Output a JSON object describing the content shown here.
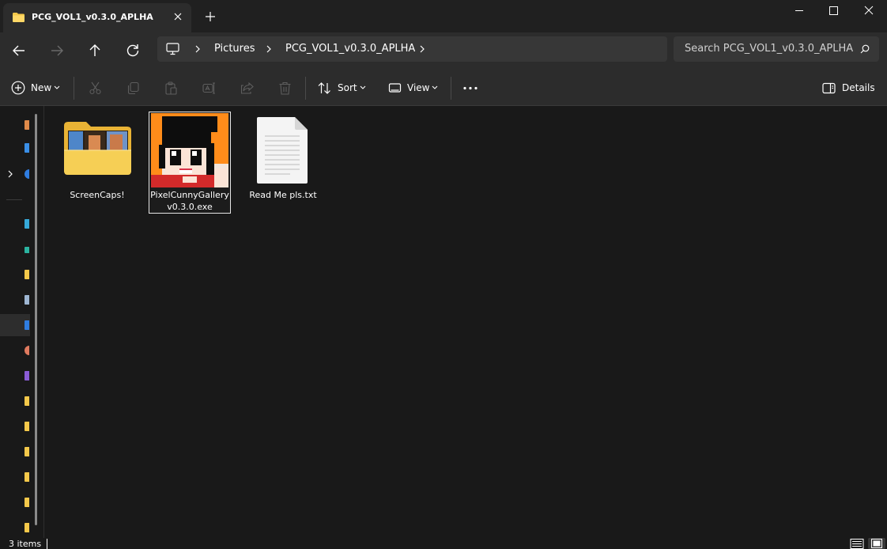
{
  "window": {
    "tab_title": "PCG_VOL1_v0.3.0_APLHA"
  },
  "nav": {
    "breadcrumb": [
      "Pictures",
      "PCG_VOL1_v0.3.0_APLHA"
    ],
    "search_placeholder": "Search PCG_VOL1_v0.3.0_APLHA"
  },
  "commands": {
    "new_label": "New",
    "sort_label": "Sort",
    "view_label": "View",
    "details_label": "Details"
  },
  "files": [
    {
      "name": "ScreenCaps!",
      "type": "folder",
      "icon": "folder-icon"
    },
    {
      "name": "PixelCunnyGallery v0.3.0.exe",
      "type": "exe",
      "icon": "app-icon",
      "selected": true
    },
    {
      "name": "Read Me pls.txt",
      "type": "text",
      "icon": "document-icon"
    }
  ],
  "status": {
    "item_count": "3 items"
  },
  "colors": {
    "background": "#191919",
    "toolbar": "#2c2c2c",
    "folder_yellow": "#f4c84a",
    "accent": "#60cdff"
  }
}
